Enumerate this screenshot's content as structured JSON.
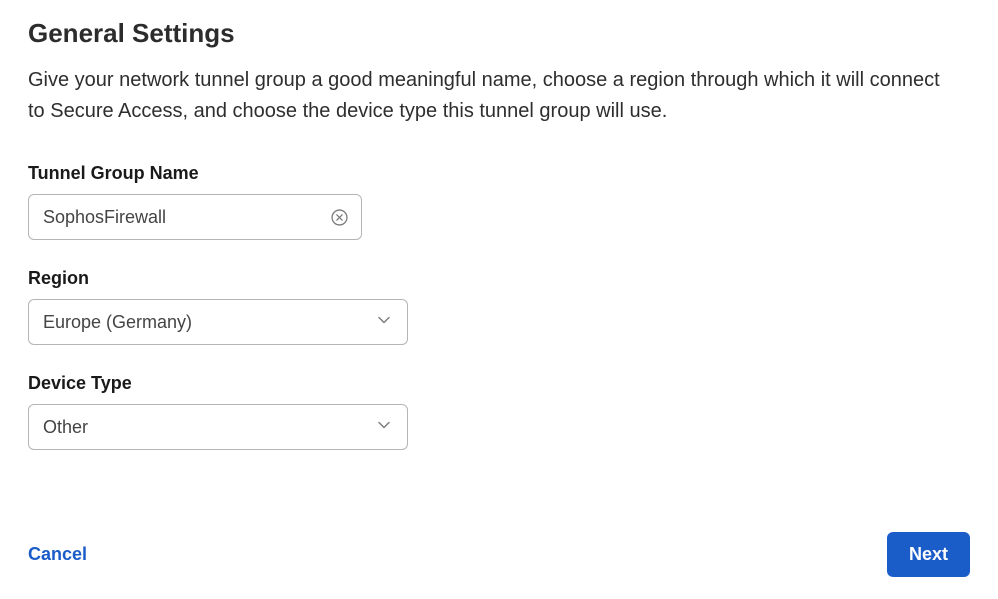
{
  "page": {
    "title": "General Settings",
    "description": "Give your network tunnel group a good meaningful name, choose a region through which it will connect to Secure Access, and choose the device type this tunnel group will use."
  },
  "form": {
    "tunnel_group_name": {
      "label": "Tunnel Group Name",
      "value": "SophosFirewall"
    },
    "region": {
      "label": "Region",
      "value": "Europe (Germany)"
    },
    "device_type": {
      "label": "Device Type",
      "value": "Other"
    }
  },
  "footer": {
    "cancel_label": "Cancel",
    "next_label": "Next"
  }
}
